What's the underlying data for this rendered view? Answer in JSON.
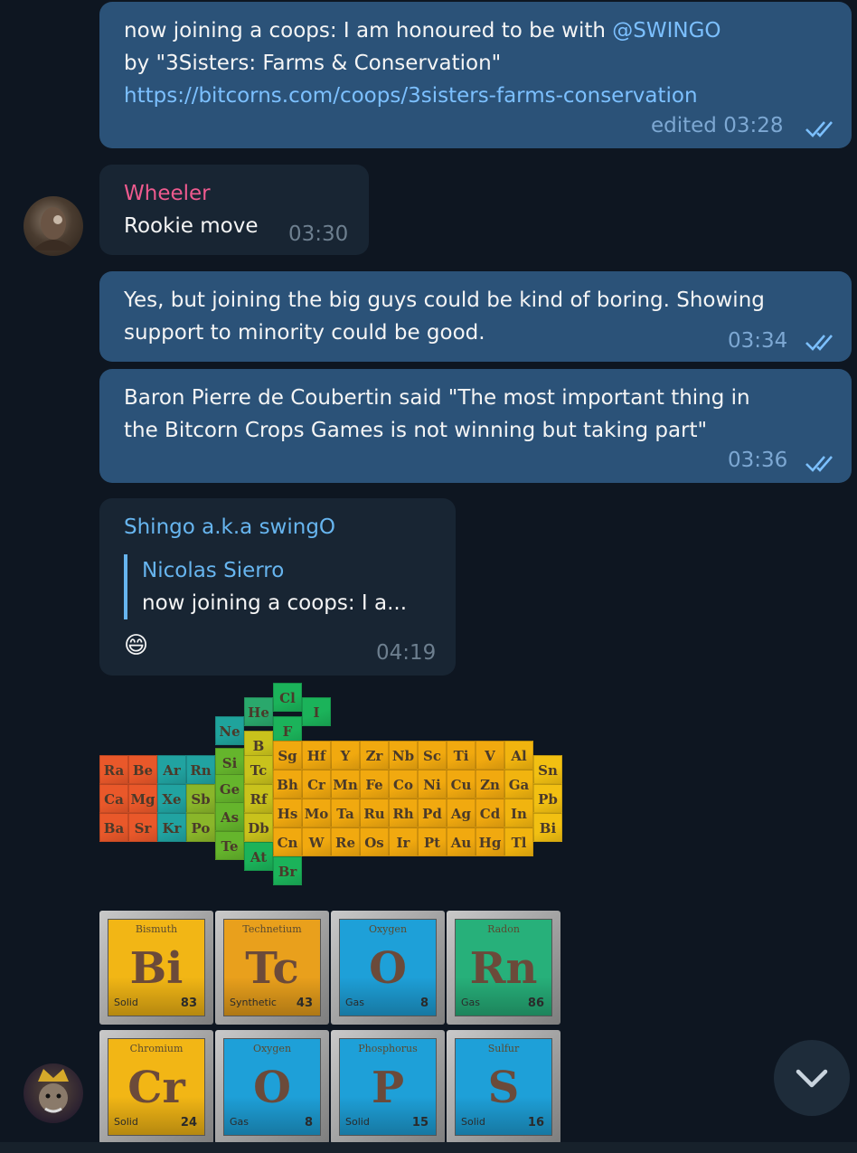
{
  "messages": [
    {
      "lines": [
        {
          "text": "now joining a coops: I am honoured to be with ",
          "mention": "@SWINGO"
        },
        {
          "text": "by \"3Sisters: Farms & Conservation\""
        },
        {
          "link": "https://bitcorns.com/coops/3sisters-farms-conservation"
        }
      ],
      "time": "edited 03:28"
    },
    {
      "sender": "Wheeler",
      "sender_color": "#ee5a8e",
      "text": "Rookie move",
      "time": "03:30"
    },
    {
      "lines": [
        "Yes, but joining the big guys could be kind of boring. Showing",
        "support to minority could be good."
      ],
      "time": "03:34"
    },
    {
      "lines": [
        "Baron Pierre de Coubertin said \"The most important thing in",
        "the Bitcorn Crops Games is not winning but taking part\""
      ],
      "time": "03:36"
    },
    {
      "sender": "Shingo a.k.a swingO",
      "sender_color": "#67b5ef",
      "reply_author": "Nicolas Sierro",
      "reply_text": "now joining a coops: I a...",
      "emoji": "😄",
      "time": "04:19"
    }
  ],
  "sticker_bitcorn": {
    "cells": [
      "Cl",
      "He",
      "I",
      "Ne",
      "F",
      "B",
      "Si",
      "Tc",
      "Sg",
      "Hf",
      "Y",
      "Zr",
      "Nb",
      "Sc",
      "Ti",
      "V",
      "Al",
      "Sn",
      "Ra",
      "Be",
      "Ar",
      "Rn",
      "Ge",
      "Rf",
      "Bh",
      "Cr",
      "Mn",
      "Fe",
      "Co",
      "Ni",
      "Cu",
      "Zn",
      "Ga",
      "Pb",
      "Ca",
      "Mg",
      "Xe",
      "Sb",
      "As",
      "Db",
      "Hs",
      "Mo",
      "Ta",
      "Ru",
      "Rh",
      "Pd",
      "Ag",
      "Cd",
      "In",
      "Bi",
      "Ba",
      "Sr",
      "Kr",
      "Po",
      "Te",
      "At",
      "Cn",
      "W",
      "Re",
      "Os",
      "Ir",
      "Pt",
      "Au",
      "Hg",
      "Tl",
      "Br"
    ]
  },
  "sticker_bitcorn_tiles": [
    {
      "name": "Bismuth",
      "symbol": "Bi",
      "state": "Solid",
      "number": "83",
      "color": "#f2b615"
    },
    {
      "name": "Technetium",
      "symbol": "Tc",
      "state": "Synthetic",
      "number": "43",
      "color": "#e9a01c"
    },
    {
      "name": "Oxygen",
      "symbol": "O",
      "state": "Gas",
      "number": "8",
      "color": "#1ea0d8"
    },
    {
      "name": "Radon",
      "symbol": "Rn",
      "state": "Gas",
      "number": "86",
      "color": "#27b07a"
    },
    {
      "name": "Chromium",
      "symbol": "Cr",
      "state": "Solid",
      "number": "24",
      "color": "#f2b615"
    },
    {
      "name": "Oxygen",
      "symbol": "O",
      "state": "Gas",
      "number": "8",
      "color": "#1ea0d8"
    },
    {
      "name": "Phosphorus",
      "symbol": "P",
      "state": "Solid",
      "number": "15",
      "color": "#1ea0d8"
    },
    {
      "name": "Sulfur",
      "symbol": "S",
      "state": "Solid",
      "number": "16",
      "color": "#1ea0d8"
    }
  ],
  "icons": {
    "read_ticks": "double-check-icon",
    "scroll_down": "chevron-down-icon"
  }
}
